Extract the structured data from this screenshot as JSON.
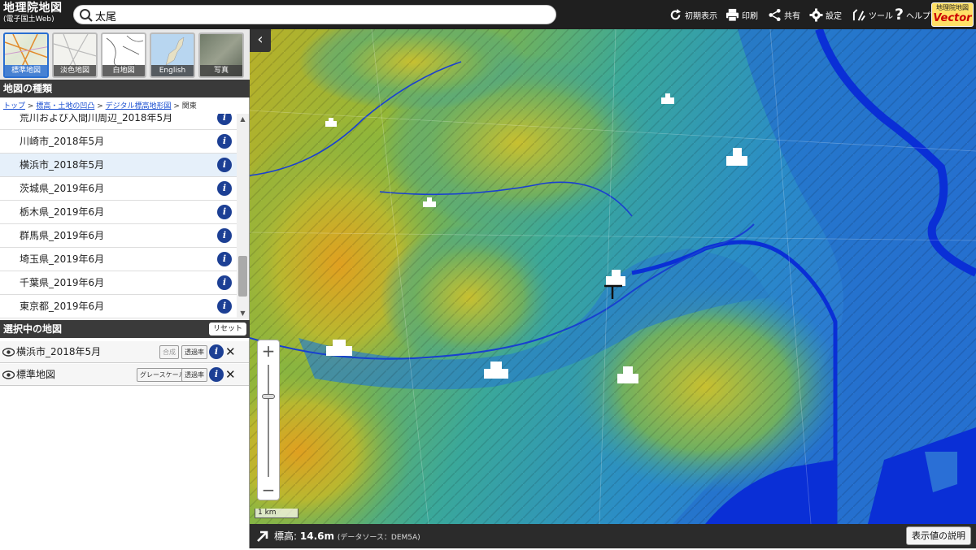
{
  "app": {
    "logo_title": "地理院地図",
    "logo_subtitle": "(電子国土Web)"
  },
  "search": {
    "value": "太尾"
  },
  "toolbar": {
    "reset_view": "初期表示",
    "print": "印刷",
    "share": "共有",
    "settings": "設定",
    "tools": "ツール",
    "help": "ヘルプ"
  },
  "vector_badge": {
    "line1": "地理院地図",
    "line2": "Vector"
  },
  "basemaps": [
    {
      "label": "標準地図",
      "selected": true
    },
    {
      "label": "淡色地図",
      "selected": false
    },
    {
      "label": "白地図",
      "selected": false
    },
    {
      "label": "English",
      "selected": false
    },
    {
      "label": "写真",
      "selected": false
    }
  ],
  "map_types": {
    "heading": "地図の種類",
    "breadcrumb": {
      "top": "トップ",
      "sep": ">",
      "level1": "標高・土地の凹凸",
      "level2": "デジタル標高地形図",
      "current": "関東"
    },
    "items": [
      {
        "label": "荒川および入間川周辺_2018年5月"
      },
      {
        "label": "川崎市_2018年5月"
      },
      {
        "label": "横浜市_2018年5月",
        "highlighted": true
      },
      {
        "label": "茨城県_2019年6月"
      },
      {
        "label": "栃木県_2019年6月"
      },
      {
        "label": "群馬県_2019年6月"
      },
      {
        "label": "埼玉県_2019年6月"
      },
      {
        "label": "千葉県_2019年6月"
      },
      {
        "label": "東京都_2019年6月"
      }
    ]
  },
  "selected_maps": {
    "heading": "選択中の地図",
    "reset_label": "リセット",
    "rows": [
      {
        "label": "横浜市_2018年5月",
        "btn1": "合成",
        "btn2": "透過率"
      },
      {
        "label": "標準地図",
        "btn1": "グレースケール",
        "btn2": "透過率"
      }
    ]
  },
  "map": {
    "scale_label": "1 km"
  },
  "status": {
    "elevation_label": "標高:",
    "elevation_value": "14.6m",
    "source": "(データソース：DEM5A)",
    "legend_button": "表示値の説明"
  },
  "colors": {
    "accent": "#2a6fd1",
    "info_icon": "#1c3f94",
    "topbar": "#1f1f1f",
    "river": "#0a2fd6"
  }
}
